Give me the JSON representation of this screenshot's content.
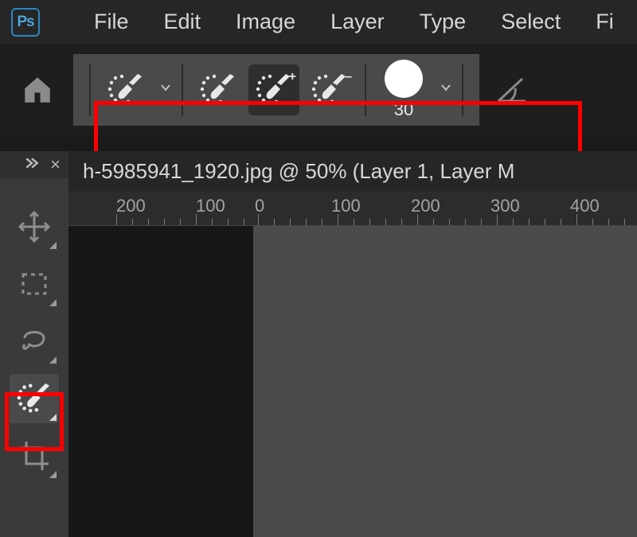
{
  "menubar": {
    "app_label": "Ps",
    "items": [
      "File",
      "Edit",
      "Image",
      "Layer",
      "Type",
      "Select",
      "Fi"
    ]
  },
  "optionsbar": {
    "brush_size": "30"
  },
  "doc": {
    "tab_title": "h-5985941_1920.jpg @ 50% (Layer 1, Layer M",
    "ruler_labels": [
      "200",
      "100",
      "0",
      "100",
      "200",
      "300",
      "400"
    ]
  },
  "icons": {
    "home": "home-icon",
    "move": "move-icon",
    "marquee": "marquee-icon",
    "lasso": "lasso-icon",
    "selection_brush": "selection-brush-icon",
    "crop": "crop-icon"
  }
}
